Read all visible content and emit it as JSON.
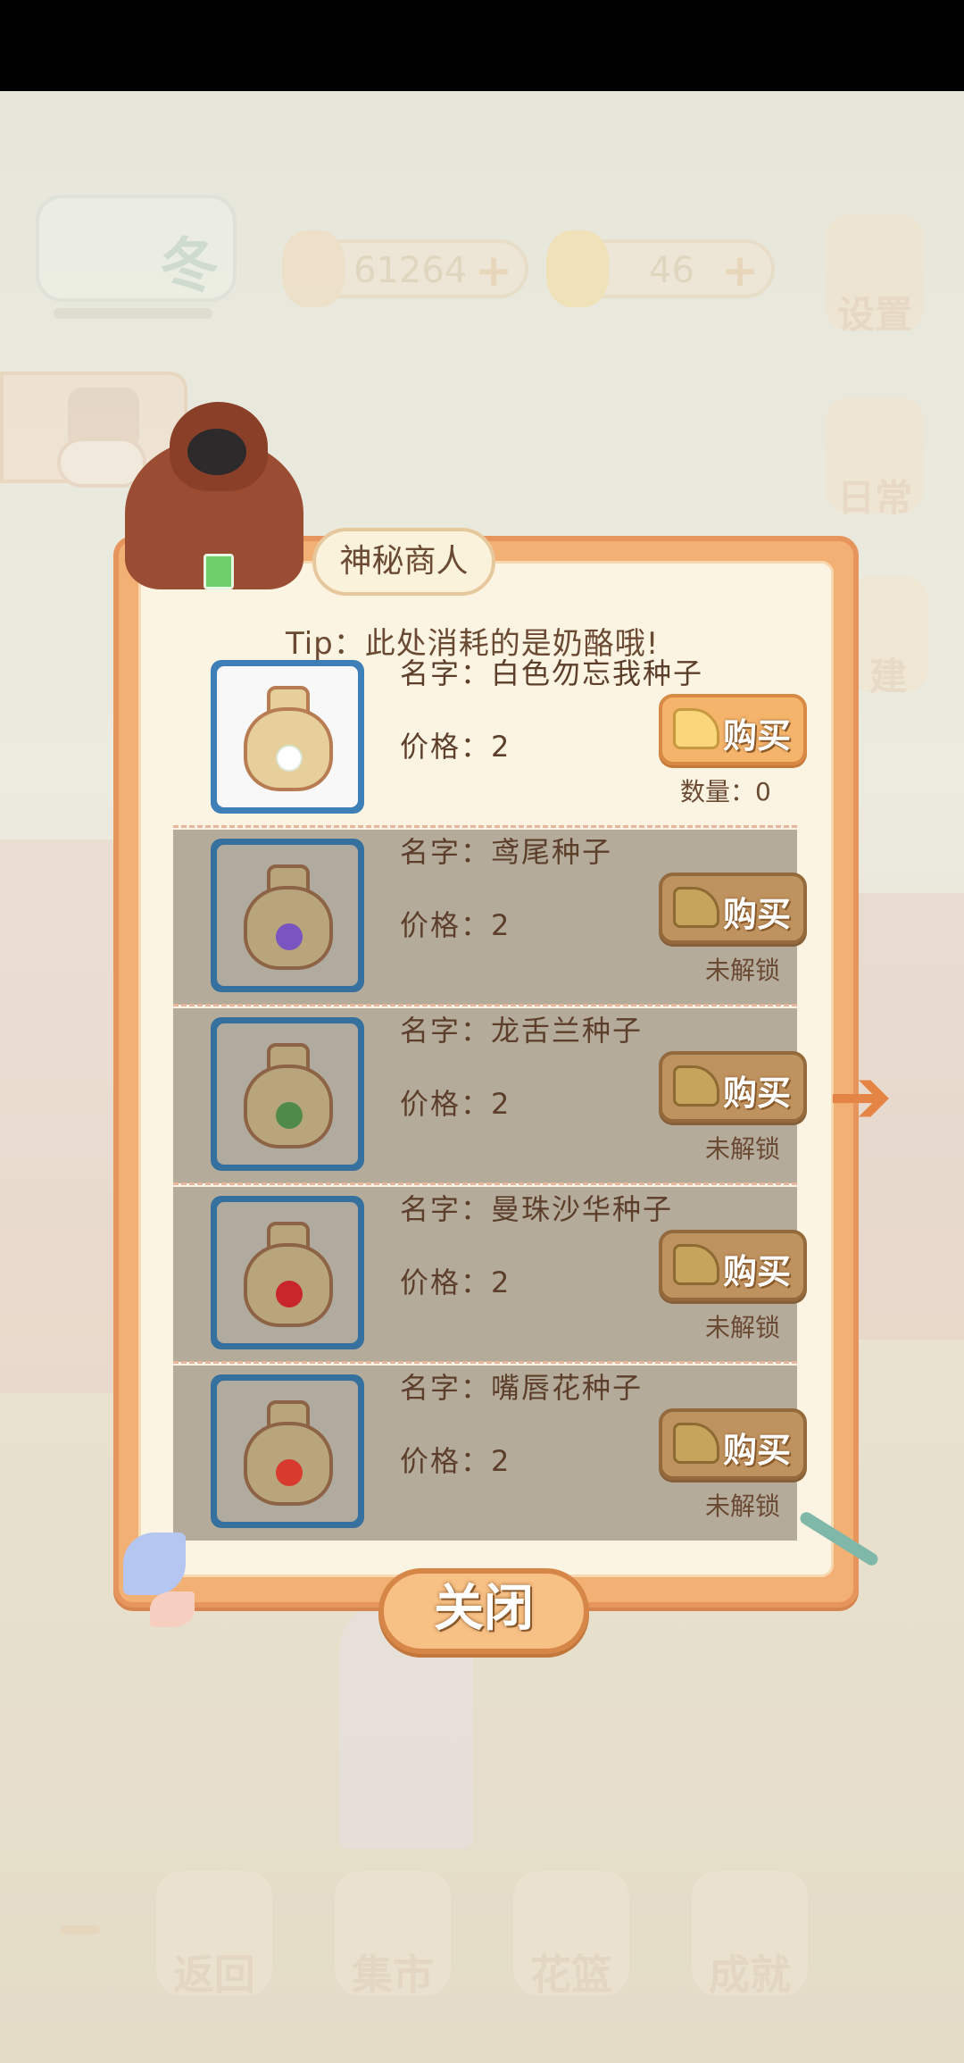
{
  "top_bar": {
    "season_label": "冬",
    "fish_currency": "61264",
    "cheese_currency": "46",
    "plus": "+",
    "settings_label": "设置",
    "daily_label": "日常",
    "build_label": "建"
  },
  "dialog": {
    "title": "神秘商人",
    "tip": "Tip：此处消耗的是奶酪哦!",
    "buy_label": "购买",
    "close_label": "关闭",
    "next_arrow": "➔",
    "items": [
      {
        "name": "名字：白色勿忘我种子",
        "price": "价格：2",
        "status": "数量：0",
        "locked": false,
        "flower_color": "#ffffff"
      },
      {
        "name": "名字：鸢尾种子",
        "price": "价格：2",
        "status": "未解锁",
        "locked": true,
        "flower_color": "#7a54c0"
      },
      {
        "name": "名字：龙舌兰种子",
        "price": "价格：2",
        "status": "未解锁",
        "locked": true,
        "flower_color": "#4f8a4a"
      },
      {
        "name": "名字：曼珠沙华种子",
        "price": "价格：2",
        "status": "未解锁",
        "locked": true,
        "flower_color": "#c8262a"
      },
      {
        "name": "名字：嘴唇花种子",
        "price": "价格：2",
        "status": "未解锁",
        "locked": true,
        "flower_color": "#d83b2e"
      }
    ]
  },
  "bottom_nav": [
    {
      "label": "返回"
    },
    {
      "label": "集市"
    },
    {
      "label": "花篮"
    },
    {
      "label": "成就"
    }
  ]
}
